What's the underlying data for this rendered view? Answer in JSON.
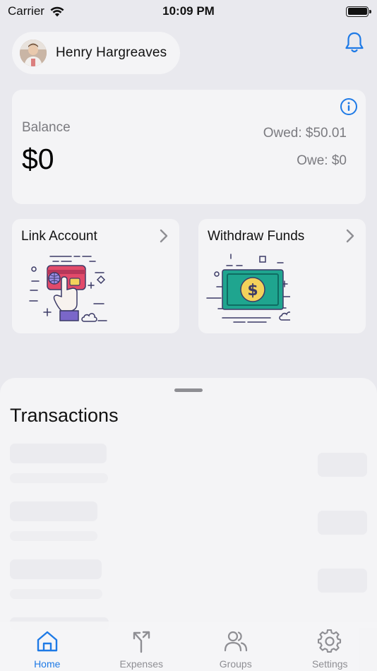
{
  "status_bar": {
    "carrier": "Carrier",
    "time": "10:09 PM"
  },
  "profile": {
    "name": "Henry Hargreaves"
  },
  "balance": {
    "label": "Balance",
    "value": "$0",
    "owed": "Owed: $50.01",
    "owe": "Owe: $0"
  },
  "actions": {
    "link_account": "Link Account",
    "withdraw_funds": "Withdraw Funds"
  },
  "transactions": {
    "title": "Transactions"
  },
  "tabs": [
    {
      "label": "Home",
      "icon": "home-icon",
      "active": true
    },
    {
      "label": "Expenses",
      "icon": "split-icon",
      "active": false
    },
    {
      "label": "Groups",
      "icon": "group-icon",
      "active": false
    },
    {
      "label": "Settings",
      "icon": "gear-icon",
      "active": false
    }
  ],
  "colors": {
    "accent": "#1e7ae6",
    "background": "#e9e9ee",
    "card": "#f4f4f6",
    "muted_text": "#7b7b80"
  }
}
